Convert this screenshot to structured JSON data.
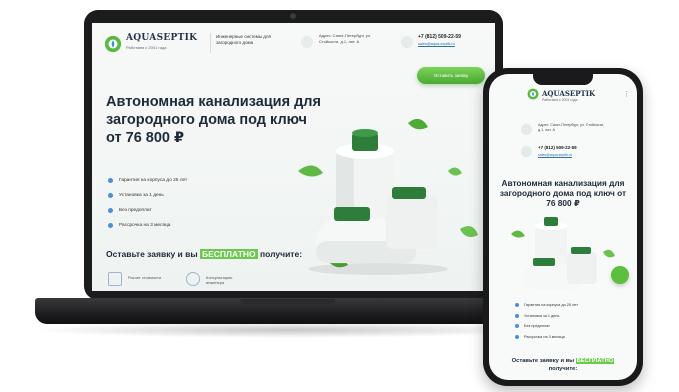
{
  "site": {
    "brand": "AQUASEPTIK",
    "tagline": "Работаем с 2001 года",
    "systems": "Инженерные системы для загородного дома",
    "address": "Адрес: Санкт-Петербург, ул. Стойкости, д.1, лит. А",
    "phone": "+7 (812) 509-22-59",
    "email": "sales@aqua-septik.ru",
    "cta": "Оставить заявку",
    "title": "Автономная канализация для загородного дома под ключ от 76 800 ₽",
    "bullets": [
      "Гарантия на корпуса до 25 лет",
      "Установка за 1 день",
      "Без предоплат",
      "Рассрочка на 3 месяца"
    ],
    "offer_before": "Оставьте заявку и вы ",
    "offer_highlight": "БЕСПЛАТНО",
    "offer_after": " получите:",
    "gifts": [
      "Расчет стоимости",
      "Консультацию инженера"
    ]
  },
  "phone_view": {
    "address": "Адрес: Санкт-Петербург, ул. Стойкости, д.1, лит. А",
    "menu_icon": "⋮",
    "offer_before": "Оставьте заявку и вы ",
    "offer_highlight": "БЕСПЛАТНО",
    "offer_after": " получите:"
  },
  "colors": {
    "accent_green": "#5cbf3d",
    "text_dark": "#1e2a3a",
    "bullet_blue": "#4a90d9",
    "device_black": "#1c1c1e"
  }
}
